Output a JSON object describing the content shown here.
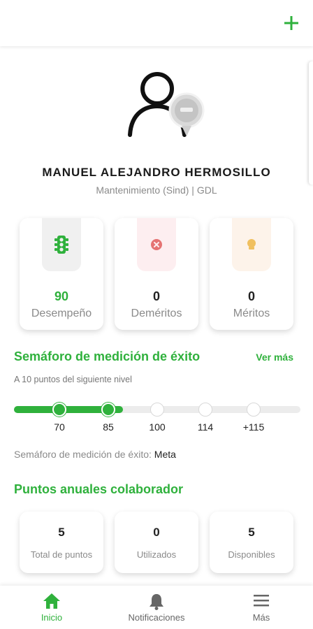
{
  "header": {
    "add_icon": "plus-icon",
    "accent": "#2fb13c"
  },
  "profile": {
    "name": "MANUEL ALEJANDRO HERMOSILLO",
    "subtitle": "Mantenimiento (Sind) | GDL",
    "avatar_icon": "user-with-badge-icon"
  },
  "stats": [
    {
      "value": "90",
      "label": "Desempeño",
      "icon": "traffic-light-icon",
      "color": "#2fb13c"
    },
    {
      "value": "0",
      "label": "Deméritos",
      "icon": "x-circle-icon",
      "color": "#e57373"
    },
    {
      "value": "0",
      "label": "Méritos",
      "icon": "medal-icon",
      "color": "#f0c060"
    }
  ],
  "semaforo": {
    "title": "Semáforo de medición de éxito",
    "ver_mas": "Ver más",
    "caption": "A 10 puntos del siguiente nivel",
    "progress_percent": 38,
    "levels": [
      {
        "label": "70",
        "reached": true
      },
      {
        "label": "85",
        "reached": true
      },
      {
        "label": "100",
        "reached": false
      },
      {
        "label": "114",
        "reached": false
      },
      {
        "label": "+115",
        "reached": false
      }
    ],
    "status_label": "Semáforo de medición de éxito:",
    "status_value": "Meta"
  },
  "puntos": {
    "title": "Puntos anuales colaborador",
    "cards": [
      {
        "value": "5",
        "label": "Total de puntos"
      },
      {
        "value": "0",
        "label": "Utilizados"
      },
      {
        "value": "5",
        "label": "Disponibles"
      }
    ]
  },
  "nav": [
    {
      "label": "Inicio",
      "icon": "home-icon",
      "active": true
    },
    {
      "label": "Notificaciones",
      "icon": "bell-icon",
      "active": false
    },
    {
      "label": "Más",
      "icon": "menu-icon",
      "active": false
    }
  ]
}
